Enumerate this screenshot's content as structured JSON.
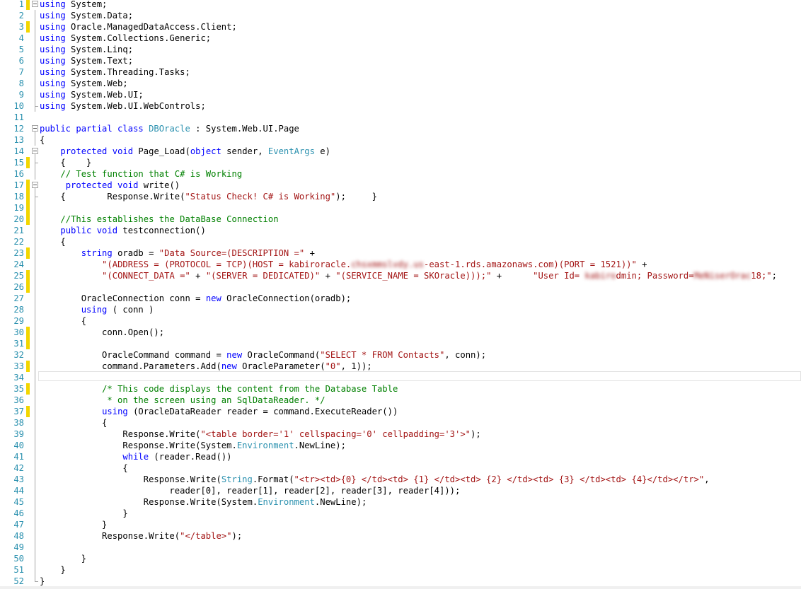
{
  "editor": {
    "language": "C#",
    "changed_lines": [
      1,
      3,
      15,
      17,
      18,
      19,
      20,
      23,
      25,
      26,
      30,
      31,
      33,
      35,
      37
    ],
    "colors": {
      "keyword": "#0000ff",
      "type": "#2b91af",
      "string": "#a31515",
      "comment": "#008000",
      "line_number": "#2b91af",
      "change_marker": "#f2d600"
    },
    "lines": [
      {
        "n": "1",
        "tokens": [
          [
            "kw",
            "using"
          ],
          [
            "p",
            " System;"
          ]
        ]
      },
      {
        "n": "2",
        "tokens": [
          [
            "kw",
            "using"
          ],
          [
            "p",
            " System.Data;"
          ]
        ]
      },
      {
        "n": "3",
        "tokens": [
          [
            "kw",
            "using"
          ],
          [
            "p",
            " Oracle.ManagedDataAccess.Client;"
          ]
        ]
      },
      {
        "n": "4",
        "tokens": [
          [
            "kw",
            "using"
          ],
          [
            "p",
            " System.Collections.Generic;"
          ]
        ]
      },
      {
        "n": "5",
        "tokens": [
          [
            "kw",
            "using"
          ],
          [
            "p",
            " System.Linq;"
          ]
        ]
      },
      {
        "n": "6",
        "tokens": [
          [
            "kw",
            "using"
          ],
          [
            "p",
            " System.Text;"
          ]
        ]
      },
      {
        "n": "7",
        "tokens": [
          [
            "kw",
            "using"
          ],
          [
            "p",
            " System.Threading.Tasks;"
          ]
        ]
      },
      {
        "n": "8",
        "tokens": [
          [
            "kw",
            "using"
          ],
          [
            "p",
            " System.Web;"
          ]
        ]
      },
      {
        "n": "9",
        "tokens": [
          [
            "kw",
            "using"
          ],
          [
            "p",
            " System.Web.UI;"
          ]
        ]
      },
      {
        "n": "10",
        "tokens": [
          [
            "kw",
            "using"
          ],
          [
            "p",
            " System.Web.UI.WebControls;"
          ]
        ]
      },
      {
        "n": "11",
        "tokens": []
      },
      {
        "n": "12",
        "tokens": [
          [
            "kw",
            "public partial class"
          ],
          [
            "p",
            " "
          ],
          [
            "ty",
            "DBOracle"
          ],
          [
            "p",
            " : System.Web.UI.Page"
          ]
        ]
      },
      {
        "n": "13",
        "tokens": [
          [
            "p",
            "{"
          ]
        ]
      },
      {
        "n": "14",
        "tokens": [
          [
            "p",
            "    "
          ],
          [
            "kw",
            "protected void"
          ],
          [
            "p",
            " Page_Load("
          ],
          [
            "kw",
            "object"
          ],
          [
            "p",
            " sender, "
          ],
          [
            "ty",
            "EventArgs"
          ],
          [
            "p",
            " e)"
          ]
        ]
      },
      {
        "n": "15",
        "tokens": [
          [
            "p",
            "    {    }"
          ]
        ]
      },
      {
        "n": "16",
        "tokens": [
          [
            "p",
            "    "
          ],
          [
            "cm",
            "// Test function that C# is Working"
          ]
        ]
      },
      {
        "n": "17",
        "tokens": [
          [
            "p",
            "     "
          ],
          [
            "kw",
            "protected void"
          ],
          [
            "p",
            " write()"
          ]
        ]
      },
      {
        "n": "18",
        "tokens": [
          [
            "p",
            "    {        Response.Write("
          ],
          [
            "st",
            "\"Status Check! C# is Working\""
          ],
          [
            "p",
            ");     }"
          ]
        ]
      },
      {
        "n": "19",
        "tokens": []
      },
      {
        "n": "20",
        "tokens": [
          [
            "p",
            "    "
          ],
          [
            "cm",
            "//This establishes the DataBase Connection"
          ]
        ]
      },
      {
        "n": "21",
        "tokens": [
          [
            "p",
            "    "
          ],
          [
            "kw",
            "public void"
          ],
          [
            "p",
            " testconnection()"
          ]
        ]
      },
      {
        "n": "22",
        "tokens": [
          [
            "p",
            "    {"
          ]
        ]
      },
      {
        "n": "23",
        "tokens": [
          [
            "p",
            "        "
          ],
          [
            "kw",
            "string"
          ],
          [
            "p",
            " oradb = "
          ],
          [
            "st",
            "\"Data Source=(DESCRIPTION =\""
          ],
          [
            "p",
            " +"
          ]
        ]
      },
      {
        "n": "24",
        "tokens": [
          [
            "p",
            "            "
          ],
          [
            "st",
            "\"(ADDRESS = (PROTOCOL = TCP)(HOST = kabiroracle."
          ],
          [
            "sb",
            "chsxmmslvdy.us"
          ],
          [
            "st",
            "-east-1.rds.amazonaws.com)(PORT = 1521))\""
          ],
          [
            "p",
            " +"
          ]
        ]
      },
      {
        "n": "25",
        "tokens": [
          [
            "p",
            "            "
          ],
          [
            "st",
            "\"(CONNECT_DATA =\""
          ],
          [
            "p",
            " + "
          ],
          [
            "st",
            "\"(SERVER = DEDICATED)\""
          ],
          [
            "p",
            " + "
          ],
          [
            "st",
            "\"(SERVICE_NAME = SKOracle)));\""
          ],
          [
            "p",
            " +      "
          ],
          [
            "st",
            "\"User Id= "
          ],
          [
            "sb",
            "kabiro"
          ],
          [
            "st",
            "dmin; Password="
          ],
          [
            "sb",
            "MeNiserOrac"
          ],
          [
            "st",
            "18;\""
          ],
          [
            "p",
            ";"
          ]
        ]
      },
      {
        "n": "26",
        "tokens": []
      },
      {
        "n": "27",
        "tokens": [
          [
            "p",
            "        OracleConnection conn = "
          ],
          [
            "kw",
            "new"
          ],
          [
            "p",
            " OracleConnection(oradb);"
          ]
        ]
      },
      {
        "n": "28",
        "tokens": [
          [
            "p",
            "        "
          ],
          [
            "kw",
            "using"
          ],
          [
            "p",
            " ( conn )"
          ]
        ]
      },
      {
        "n": "29",
        "tokens": [
          [
            "p",
            "        {"
          ]
        ]
      },
      {
        "n": "30",
        "tokens": [
          [
            "p",
            "            conn.Open();"
          ]
        ]
      },
      {
        "n": "31",
        "tokens": []
      },
      {
        "n": "32",
        "tokens": [
          [
            "p",
            "            OracleCommand command = "
          ],
          [
            "kw",
            "new"
          ],
          [
            "p",
            " OracleCommand("
          ],
          [
            "st",
            "\"SELECT * FROM Contacts\""
          ],
          [
            "p",
            ", conn);"
          ]
        ]
      },
      {
        "n": "33",
        "tokens": [
          [
            "p",
            "            command.Parameters.Add("
          ],
          [
            "kw",
            "new"
          ],
          [
            "p",
            " OracleParameter("
          ],
          [
            "st",
            "\"0\""
          ],
          [
            "p",
            ", 1));"
          ]
        ]
      },
      {
        "n": "34",
        "tokens": []
      },
      {
        "n": "35",
        "tokens": [
          [
            "p",
            "            "
          ],
          [
            "cm",
            "/* This code displays the content from the Database Table"
          ]
        ]
      },
      {
        "n": "36",
        "tokens": [
          [
            "cm",
            "             * on the screen using an SqlDataReader. */"
          ]
        ]
      },
      {
        "n": "37",
        "tokens": [
          [
            "p",
            "            "
          ],
          [
            "kw",
            "using"
          ],
          [
            "p",
            " (OracleDataReader reader = command.ExecuteReader())"
          ]
        ]
      },
      {
        "n": "38",
        "tokens": [
          [
            "p",
            "            {"
          ]
        ]
      },
      {
        "n": "39",
        "tokens": [
          [
            "p",
            "                Response.Write("
          ],
          [
            "st",
            "\"<table border='1' cellspacing='0' cellpadding='3'>\""
          ],
          [
            "p",
            ");"
          ]
        ]
      },
      {
        "n": "40",
        "tokens": [
          [
            "p",
            "                Response.Write(System."
          ],
          [
            "ty",
            "Environment"
          ],
          [
            "p",
            ".NewLine);"
          ]
        ]
      },
      {
        "n": "41",
        "tokens": [
          [
            "p",
            "                "
          ],
          [
            "kw",
            "while"
          ],
          [
            "p",
            " (reader.Read())"
          ]
        ]
      },
      {
        "n": "42",
        "tokens": [
          [
            "p",
            "                {"
          ]
        ]
      },
      {
        "n": "43",
        "tokens": [
          [
            "p",
            "                    Response.Write("
          ],
          [
            "ty",
            "String"
          ],
          [
            "p",
            ".Format("
          ],
          [
            "st",
            "\"<tr><td>{0} </td><td> {1} </td><td> {2} </td><td> {3} </td><td> {4}</td></tr>\""
          ],
          [
            "p",
            ","
          ]
        ]
      },
      {
        "n": "44",
        "tokens": [
          [
            "p",
            "                         reader[0], reader[1], reader[2], reader[3], reader[4]));"
          ]
        ]
      },
      {
        "n": "45",
        "tokens": [
          [
            "p",
            "                    Response.Write(System."
          ],
          [
            "ty",
            "Environment"
          ],
          [
            "p",
            ".NewLine);"
          ]
        ]
      },
      {
        "n": "46",
        "tokens": [
          [
            "p",
            "                }"
          ]
        ]
      },
      {
        "n": "47",
        "tokens": [
          [
            "p",
            "            }"
          ]
        ]
      },
      {
        "n": "48",
        "tokens": [
          [
            "p",
            "            Response.Write("
          ],
          [
            "st",
            "\"</table>\""
          ],
          [
            "p",
            ");"
          ]
        ]
      },
      {
        "n": "49",
        "tokens": []
      },
      {
        "n": "50",
        "tokens": [
          [
            "p",
            "        }"
          ]
        ]
      },
      {
        "n": "51",
        "tokens": [
          [
            "p",
            "    }"
          ]
        ]
      },
      {
        "n": "52",
        "tokens": [
          [
            "p",
            "}"
          ]
        ]
      }
    ]
  }
}
